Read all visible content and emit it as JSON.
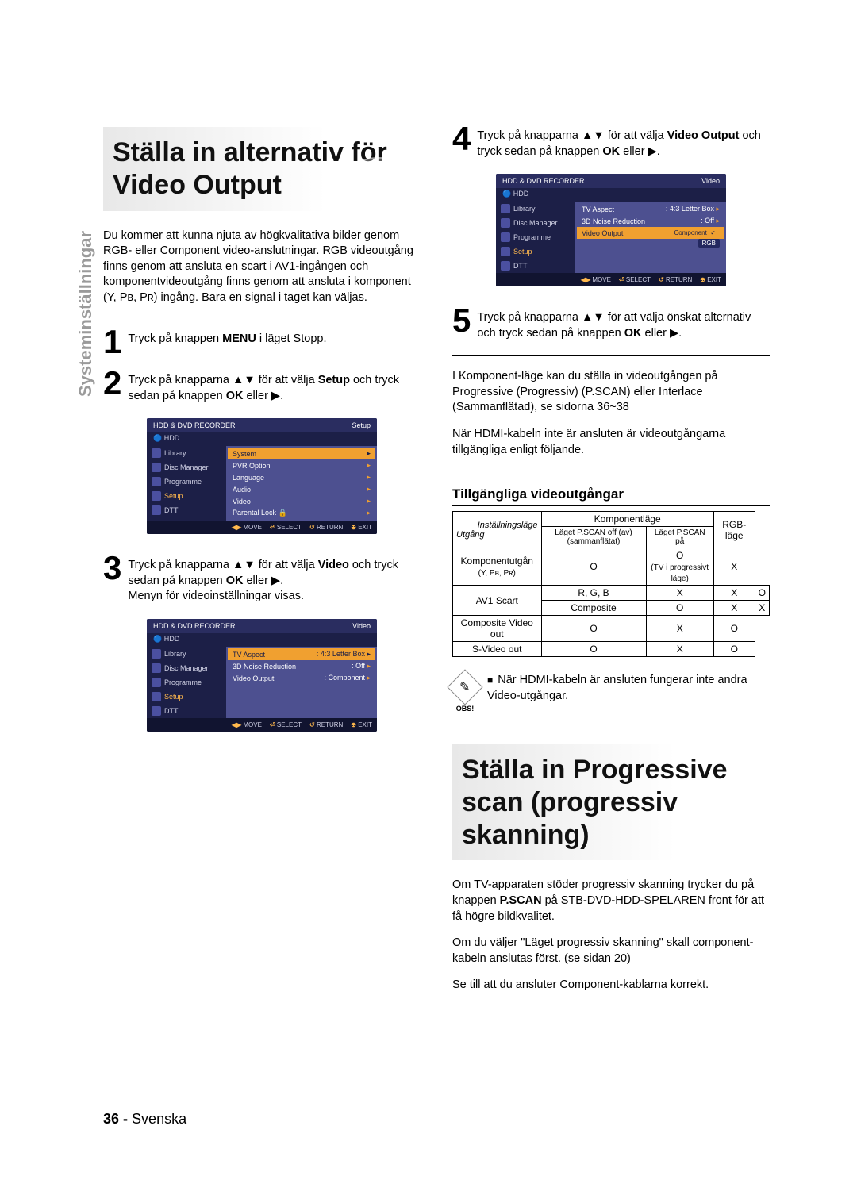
{
  "side_label": "Systeminställningar",
  "left": {
    "title": "Ställa in alternativ för Video Output",
    "intro": "Du kommer att kunna njuta av högkvalitativa bilder genom RGB- eller Component video-anslutningar. RGB videoutgång finns genom att ansluta en scart i AV1-ingången och komponentvideoutgång finns genom att ansluta i komponent (Y, Pʙ, Pʀ) ingång. Bara en signal i taget kan väljas.",
    "step1": {
      "num": "1",
      "text_a": "Tryck på knappen ",
      "text_b": "MENU",
      "text_c": " i läget Stopp."
    },
    "step2": {
      "num": "2",
      "text_a": "Tryck på knapparna ▲▼ för att välja ",
      "text_b": "Setup",
      "text_c": " och tryck sedan på knappen ",
      "text_d": "OK",
      "text_e": " eller ▶."
    },
    "step3": {
      "num": "3",
      "text_a": "Tryck på knapparna ▲▼ för att välja ",
      "text_b": "Video",
      "text_c": " och tryck sedan på knappen ",
      "text_d": "OK",
      "text_e": " eller ▶.",
      "text_f": "Menyn för videoinställningar visas."
    }
  },
  "right": {
    "step4": {
      "num": "4",
      "text_a": "Tryck på knapparna ▲▼ för att välja ",
      "text_b": "Video Output",
      "text_c": " och tryck sedan på knappen ",
      "text_d": "OK",
      "text_e": " eller ▶."
    },
    "step5": {
      "num": "5",
      "text_a": "Tryck på knapparna ▲▼ för att välja önskat alternativ och tryck sedan på knappen ",
      "text_b": "OK",
      "text_c": " eller ▶."
    },
    "para1": "I Komponent-läge kan du ställa in videoutgången på Progressive (Progressiv) (P.SCAN) eller Interlace (Sammanflätad), se sidorna 36~38",
    "para2": "När HDMI-kabeln inte är ansluten är videoutgångarna tillgängliga enligt följande.",
    "avail_heading": "Tillgängliga videoutgångar",
    "table": {
      "h_setting": "Inställningsläge",
      "h_output": "Utgång",
      "h_comp": "Komponentläge",
      "h_pscan_off": "Läget P.SCAN off (av) (sammanflätat)",
      "h_pscan_on": "Läget P.SCAN på",
      "h_rgb": "RGB-läge",
      "rows": [
        {
          "label_a": "Komponentutgån",
          "label_b": "(Y, Pʙ, Pʀ)",
          "c1": "O",
          "c2_a": "O",
          "c2_b": "(TV i progressivt läge)",
          "c3": "X"
        },
        {
          "label_a": "AV1 Scart",
          "sub1": "R, G, B",
          "sub1_c1": "X",
          "sub1_c2": "X",
          "sub1_c3": "O",
          "sub2": "Composite",
          "sub2_c1": "O",
          "sub2_c2": "X",
          "sub2_c3": "X"
        },
        {
          "label_a": "Composite Video out",
          "c1": "O",
          "c2": "X",
          "c3": "O"
        },
        {
          "label_a": "S-Video out",
          "c1": "O",
          "c2": "X",
          "c3": "O"
        }
      ]
    },
    "note_obs": "OBS!",
    "note_text": "När HDMI-kabeln är ansluten fungerar inte andra Video-utgångar.",
    "title2": "Ställa in Progressive scan (progressiv skanning)",
    "para3_a": "Om TV-apparaten stöder progressiv skanning trycker du på knappen ",
    "para3_b": "P.SCAN",
    "para3_c": " på STB-DVD-HDD-SPELAREN front för att få högre bildkvalitet.",
    "para4": "Om du väljer \"Läget progressiv skanning\" skall component-kabeln anslutas först. (se sidan 20)",
    "para5": "Se till att du ansluter Component-kablarna korrekt."
  },
  "osd": {
    "title": "HDD & DVD RECORDER",
    "hdd": "HDD",
    "top_setup": "Setup",
    "top_video": "Video",
    "side_items": [
      "Library",
      "Disc Manager",
      "Programme",
      "Setup",
      "DTT"
    ],
    "setup_rows": [
      {
        "l": "System",
        "hl": true
      },
      {
        "l": "PVR Option"
      },
      {
        "l": "Language"
      },
      {
        "l": "Audio"
      },
      {
        "l": "Video"
      },
      {
        "l": "Parental Lock 🔒"
      }
    ],
    "video_rows": [
      {
        "l": "TV Aspect",
        "r": ": 4:3 Letter Box"
      },
      {
        "l": "3D Noise Reduction",
        "r": ": Off"
      },
      {
        "l": "Video Output",
        "r": ": Component"
      }
    ],
    "video_rows_dd": [
      {
        "l": "TV Aspect",
        "r": ": 4:3 Letter Box"
      },
      {
        "l": "3D Noise Reduction",
        "r": ": Off"
      },
      {
        "l": "Video Output",
        "r_options": [
          "Component",
          "RGB"
        ]
      }
    ],
    "bottom": {
      "move": "MOVE",
      "select": "SELECT",
      "return": "RETURN",
      "exit": "EXIT"
    }
  },
  "footer": {
    "page": "36 -",
    "lang": "Svenska"
  }
}
